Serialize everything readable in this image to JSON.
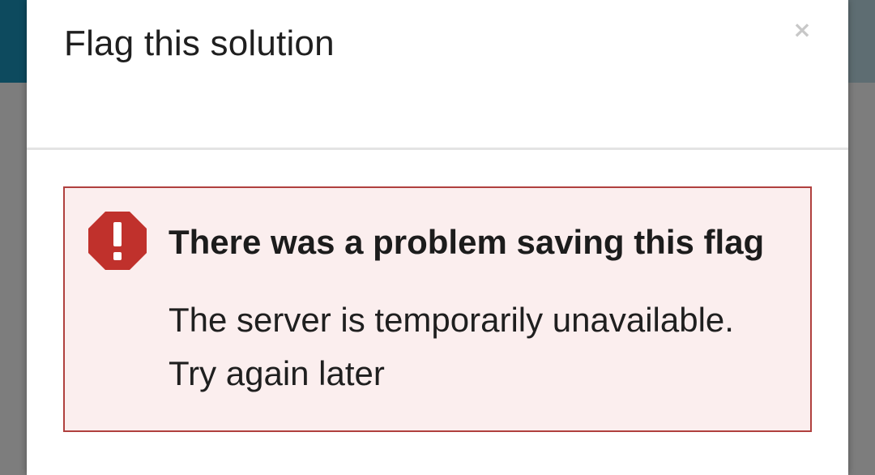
{
  "dialog": {
    "title": "Flag this solution",
    "close_label": "×"
  },
  "alert": {
    "icon": "error-octagon-icon",
    "title": "There was a problem saving this flag",
    "message_line1": "The server is temporarily unavailable.",
    "message_line2": "Try again later"
  },
  "colors": {
    "alert_border": "#b0403e",
    "alert_background": "#fbeeee",
    "error_icon": "#c0312c"
  }
}
